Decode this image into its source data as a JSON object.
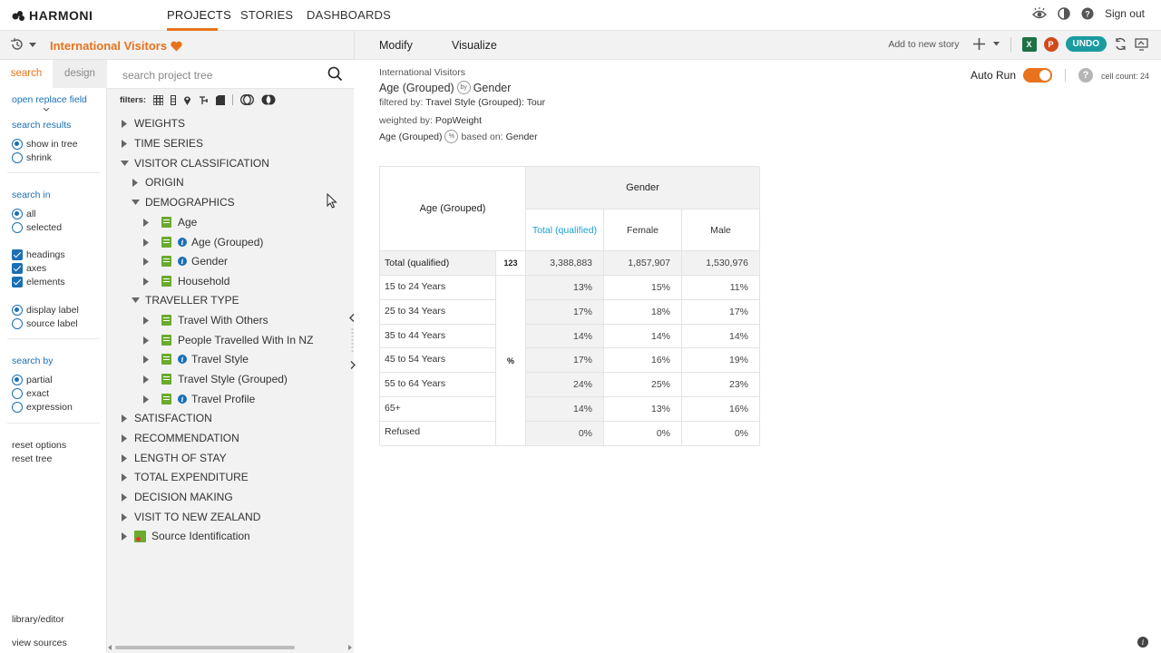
{
  "app": {
    "brand": "HARMONI"
  },
  "nav": {
    "tabs": [
      "PROJECTS",
      "STORIES",
      "DASHBOARDS"
    ],
    "signout": "Sign out"
  },
  "project": {
    "title": "International Visitors"
  },
  "leftcol": {
    "tabs": {
      "search": "search",
      "design": "design"
    },
    "open_replace": "open replace field",
    "search_results": "search results",
    "show_in_tree": "show in tree",
    "shrink": "shrink",
    "search_in": "search in",
    "all": "all",
    "selected": "selected",
    "headings": "headings",
    "axes": "axes",
    "elements": "elements",
    "display_label": "display label",
    "source_label": "source label",
    "search_by": "search by",
    "partial": "partial",
    "exact": "exact",
    "expression": "expression",
    "reset_options": "reset options",
    "reset_tree": "reset tree",
    "library_editor": "library/editor",
    "view_sources": "view sources"
  },
  "tree": {
    "placeholder": "search project tree",
    "filters_label": "filters:",
    "items": [
      {
        "label": "WEIGHTS"
      },
      {
        "label": "TIME SERIES"
      },
      {
        "label": "VISITOR CLASSIFICATION"
      },
      {
        "label": "ORIGIN"
      },
      {
        "label": "DEMOGRAPHICS"
      },
      {
        "label": "Age"
      },
      {
        "label": "Age (Grouped)"
      },
      {
        "label": "Gender"
      },
      {
        "label": "Household"
      },
      {
        "label": "TRAVELLER TYPE"
      },
      {
        "label": "Travel With Others"
      },
      {
        "label": "People Travelled With In NZ"
      },
      {
        "label": "Travel Style"
      },
      {
        "label": "Travel Style (Grouped)"
      },
      {
        "label": "Travel Profile"
      },
      {
        "label": "SATISFACTION"
      },
      {
        "label": "RECOMMENDATION"
      },
      {
        "label": "LENGTH OF STAY"
      },
      {
        "label": "TOTAL EXPENDITURE"
      },
      {
        "label": "DECISION MAKING"
      },
      {
        "label": "VISIT TO NEW ZEALAND"
      },
      {
        "label": "Source Identification"
      }
    ]
  },
  "main": {
    "tabs": {
      "modify": "Modify",
      "visualize": "Visualize"
    },
    "add_story": "Add to new story",
    "undo": "UNDO",
    "excel_letter": "X",
    "ppt_letter": "P",
    "auto_run": "Auto Run",
    "cell_count": "cell count: 24",
    "help": "?",
    "meta": {
      "source": "International Visitors",
      "row_var": "Age (Grouped)",
      "by": "by",
      "col_var": "Gender",
      "filtered_label": "filtered by:",
      "filtered_value": "Travel Style (Grouped): Tour",
      "weighted_label": "weighted by:",
      "weighted_value": "PopWeight",
      "pct_var": "Age (Grouped)",
      "pct_symbol": "%",
      "based_label": "based on:",
      "based_value": "Gender"
    }
  },
  "table": {
    "row_header": "Age (Grouped)",
    "col_group": "Gender",
    "columns": [
      "Total (qualified)",
      "Female",
      "Male"
    ],
    "total_row": {
      "label": "Total (qualified)",
      "stat": "123",
      "values": [
        "3,388,883",
        "1,857,907",
        "1,530,976"
      ]
    },
    "pct_stat": "%",
    "rows": [
      {
        "label": "15 to 24 Years",
        "values": [
          "13%",
          "15%",
          "11%"
        ]
      },
      {
        "label": "25 to 34 Years",
        "values": [
          "17%",
          "18%",
          "17%"
        ]
      },
      {
        "label": "35 to 44 Years",
        "values": [
          "14%",
          "14%",
          "14%"
        ]
      },
      {
        "label": "45 to 54 Years",
        "values": [
          "17%",
          "16%",
          "19%"
        ]
      },
      {
        "label": "55 to 64 Years",
        "values": [
          "24%",
          "25%",
          "23%"
        ]
      },
      {
        "label": "65+",
        "values": [
          "14%",
          "13%",
          "16%"
        ]
      },
      {
        "label": "Refused",
        "values": [
          "0%",
          "0%",
          "0%"
        ]
      }
    ]
  },
  "colors": {
    "accent": "#e8731c",
    "link": "#1a6fb5",
    "undo": "#1a9ba0",
    "variable": "#6aaa2e"
  },
  "icons": [
    "history-icon",
    "heart-icon",
    "search-icon",
    "eye-icon",
    "contrast-icon",
    "help-icon",
    "plus-icon",
    "excel-icon",
    "powerpoint-icon",
    "refresh-icon",
    "popout-icon"
  ]
}
